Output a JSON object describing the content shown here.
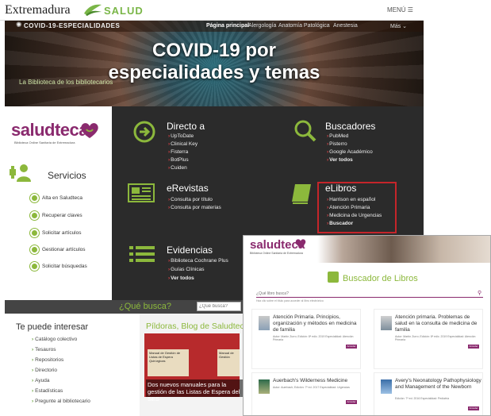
{
  "header": {
    "brand": "Extremadura",
    "salud": "SALUD",
    "menu": "MENÚ ☰"
  },
  "hero": {
    "tag": "COVID-19-ESPECIALIDADES",
    "nav": [
      "Página principal",
      "Alergología",
      "Anatomía Patológica",
      "Anestesia",
      "Más ⌄"
    ],
    "title_line1": "COVID-19 por",
    "title_line2": "especialidades y temas",
    "subtitle": "La Biblioteca de los bibliotecarios"
  },
  "saludteca": {
    "name": "saludteca",
    "tag": "Biblioteca Online Sanitaria de Extremadura"
  },
  "servicios": {
    "title": "Servicios",
    "items": [
      "Alta en Saludteca",
      "Recuperar claves",
      "Solicitar artículos",
      "Gestionar artículos",
      "Solicitar búsquedas"
    ]
  },
  "sections": {
    "directo": {
      "title": "Directo a",
      "links": [
        "UpToDate",
        "Clinical Key",
        "Fisterra",
        "BotPlus",
        "Cuiden"
      ]
    },
    "buscadores": {
      "title": "Buscadores",
      "links": [
        "PubMed",
        "Pisterro",
        "Google Académico",
        "Ver todos"
      ]
    },
    "erevistas": {
      "title": "eRevistas",
      "links": [
        "Consulta por título",
        "Consulta por materias"
      ]
    },
    "elibros": {
      "title": "eLibros",
      "links": [
        "Harrison en español",
        "Atención Primaria",
        "Medicina de Urgencias",
        "Buscador"
      ]
    },
    "evidencias": {
      "title": "Evidencias",
      "links": [
        "Biblioteca Cochrane Plus",
        "Guías Clínicas",
        "Ver todos"
      ]
    }
  },
  "search": {
    "label": "¿Qué busca?",
    "placeholder": "¿Qué busca?"
  },
  "interesar": {
    "title": "Te puede interesar",
    "items": [
      "Catálogo colectivo",
      "Tesauros",
      "Repositorios",
      "Directorio",
      "Ayuda",
      "Estadísticas",
      "Pregunte al bibliotecario"
    ]
  },
  "pildoras": {
    "title": "Píldoras, Blog de Saludteca",
    "doc1": "Manual de Gestión de Listas de Espera Quirúrgicas",
    "doc2": "Manual de Gestión",
    "caption": "Dos nuevos manuales para la gestión de las Listas de Espera del SES"
  },
  "overlay": {
    "brand": "saludteca",
    "tag": "Biblioteca Online Sanitaria de Extremadura",
    "title": "Buscador de Libros",
    "search_placeholder": "¿Qué libro busca?",
    "note": "Haz clic sobre el título para acceder al libro electrónico",
    "books": [
      {
        "title": "Atención Primaria. Principios, organización y métodos en medicina de familia",
        "meta": "Autor: Martín Zurro; Edición: 8ª edic. 2019 Especialidad: Atención Primaria",
        "btn": "Acceder"
      },
      {
        "title": "Atención primaria. Problemas de salud en la consulta de medicina de familia",
        "meta": "Autor: Martín Zurro; Edición: 8ª edic. 2019 Especialidad: Atención Primaria",
        "btn": "Acceder"
      },
      {
        "title": "Auerbach's Wilderness Medicine",
        "meta": "Autor: Auerbach; Edición: 7ª ed. 2017 Especialidad: Urgencias",
        "btn": "Acceder"
      },
      {
        "title": "Avery's Neonatology Pathophysiology and Management of the Newborn",
        "meta": "Edición: 7ª ed. 2016 Especialidad: Pediatría",
        "btn": "Acceder"
      }
    ]
  }
}
